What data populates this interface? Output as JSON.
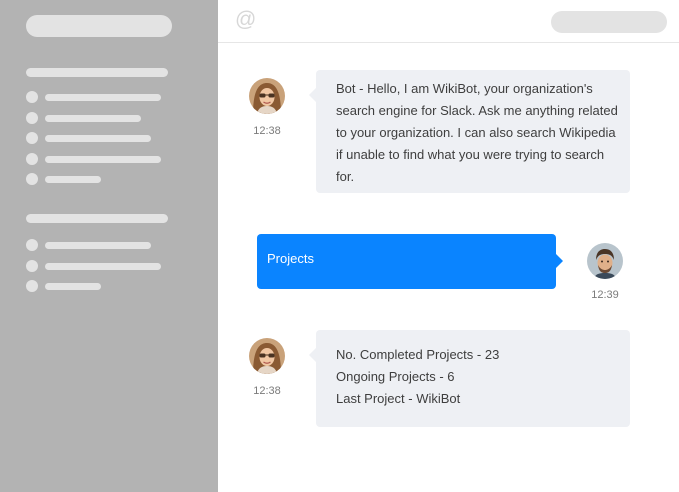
{
  "messages": [
    {
      "direction": "incoming",
      "avatar": "female-avatar",
      "time": "12:38",
      "lines": [
        "Bot - Hello, I am WikiBot, your organization's",
        "search engine for Slack. Ask me anything related",
        "to your organization. I can also search Wikipedia",
        "if unable to find what you were trying to search",
        "for."
      ]
    },
    {
      "direction": "outgoing",
      "avatar": "male-avatar",
      "time": "12:39",
      "lines": [
        "Projects"
      ]
    },
    {
      "direction": "incoming",
      "avatar": "female-avatar",
      "time": "12:38",
      "lines": [
        "No. Completed Projects - 23",
        "Ongoing Projects - 6",
        "Last Project - WikiBot"
      ]
    }
  ],
  "colors": {
    "sidebar": "#b3b3b3",
    "placeholder": "#e3e3e3",
    "incoming_bubble": "#eef0f4",
    "outgoing_bubble": "#0a84ff"
  },
  "icons": {
    "header_left": "at-icon"
  }
}
